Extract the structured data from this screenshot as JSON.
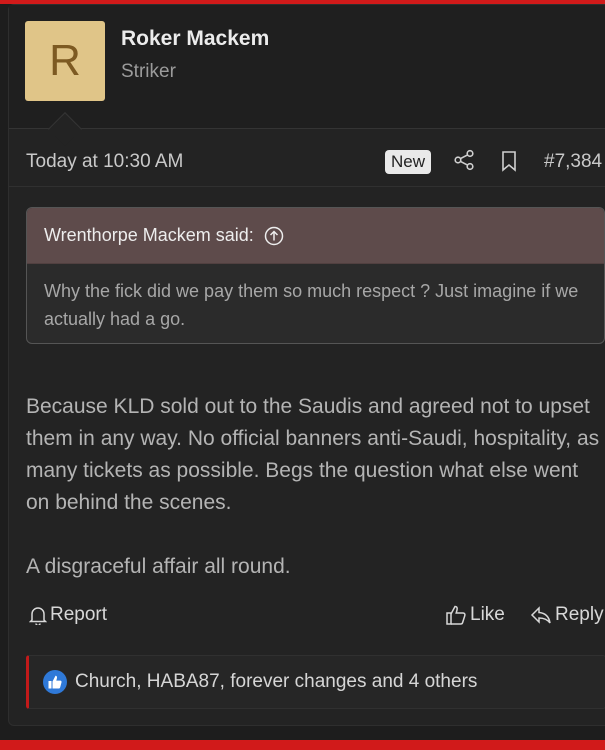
{
  "user": {
    "avatar_letter": "R",
    "name": "Roker Mackem",
    "title": "Striker"
  },
  "meta": {
    "timestamp": "Today at 10:30 AM",
    "badge": "New",
    "post_number": "#7,384"
  },
  "quote": {
    "author": "Wrenthorpe Mackem said:",
    "text": "Why the fick did we pay them so much respect ? Just imagine if we actually had a go."
  },
  "message": {
    "paragraph_1": "Because KLD sold out to the Saudis and agreed not to upset them in any way. No official banners anti-Saudi, hospitality, as many tickets as possible. Begs the question what else went on behind the scenes.",
    "paragraph_2": "A disgraceful affair all round."
  },
  "actions": {
    "report": "Report",
    "like": "Like",
    "reply": "Reply"
  },
  "reactions": {
    "text": "Church, HABA87, forever changes and 4 others"
  },
  "colors": {
    "accent": "#d11a1a",
    "quote_header": "#5e4b4b",
    "like_blue": "#2f79d8",
    "avatar": "#e0c588"
  }
}
